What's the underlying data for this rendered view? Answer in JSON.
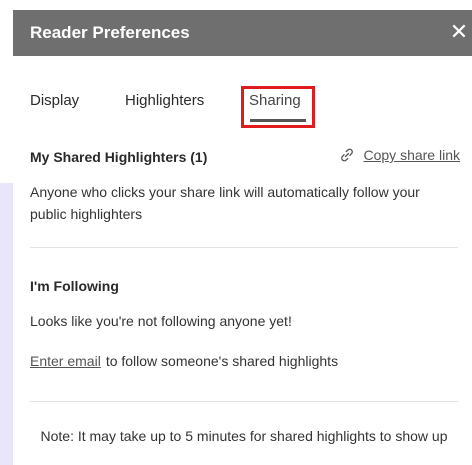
{
  "window": {
    "title": "Reader Preferences",
    "close_icon": "close-icon"
  },
  "tabs": [
    {
      "label": "Display",
      "active": false
    },
    {
      "label": "Highlighters",
      "active": false
    },
    {
      "label": "Sharing",
      "active": true
    }
  ],
  "shared": {
    "header": "My Shared Highlighters (1)",
    "copy_link_icon": "link-icon",
    "copy_link_label": "Copy share link",
    "description": "Anyone who clicks your share link will automatically follow your public highlighters"
  },
  "following": {
    "header": "I'm Following",
    "status": "Looks like you're not following anyone yet!",
    "enter_email_link": "Enter email",
    "enter_email_text": "to follow someone's shared highlights"
  },
  "note": "Note: It may take up to 5 minutes for shared highlights to show up",
  "colors": {
    "titlebar": "#6f6f6f",
    "highlight_box": "#e01b1b",
    "left_strip": "#e8e6f8"
  }
}
